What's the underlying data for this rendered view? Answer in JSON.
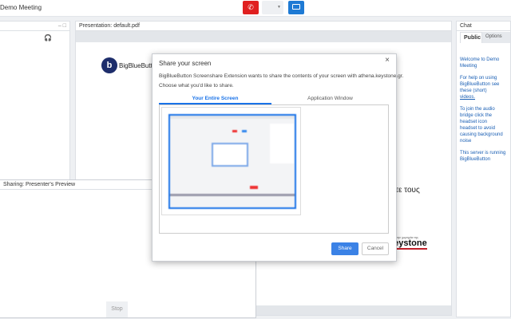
{
  "topbar": {
    "title": "Demo Meeting"
  },
  "left_panel": {
    "min": "–",
    "max": "□"
  },
  "presentation": {
    "title": "Presentation: default.pdf",
    "logo_text": "BigBlueButton",
    "slide_text": "τε τους",
    "sponsor_small": "με την χορηγία της",
    "sponsor_logo": "keystone"
  },
  "chat": {
    "title": "Chat",
    "tabs": [
      "Public",
      "Options"
    ],
    "messages": [
      "Welcome to Demo Meeting",
      "For help on using BigBlueButton see these (short)",
      "videos.",
      "To join the audio bridge click the headset icon",
      "headset to avoid causing background noise",
      "This server is running BigBlueButton"
    ]
  },
  "preview": {
    "title": "Sharing: Presenter's Preview",
    "stop": "Stop"
  },
  "dialog": {
    "title": "Share your screen",
    "close": "×",
    "line1": "BigBlueButton Screenshare Extension wants to share the contents of your screen with athena.keystone.gr.",
    "line2": "Choose what you'd like to share.",
    "tabs": [
      "Your Entire Screen",
      "Application Window"
    ],
    "share": "Share",
    "cancel": "Cancel"
  },
  "colors": {
    "accent": "#1a73e8",
    "danger": "#e02020"
  }
}
